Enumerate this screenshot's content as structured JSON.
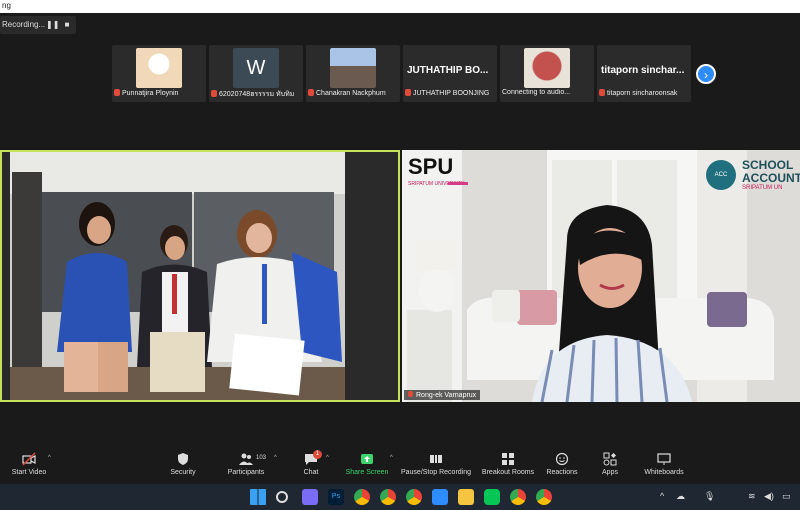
{
  "window": {
    "title": "ng"
  },
  "recording": {
    "label": "Recording...",
    "pause_icon": "pause-icon",
    "stop_icon": "stop-icon"
  },
  "participants_strip": [
    {
      "name": "Punnatjira Ploynin",
      "kind": "image",
      "color": "#e8c8a8"
    },
    {
      "name": "62020748ฮรรรรม ทับทิม",
      "kind": "avatar",
      "avatar_letter": "W",
      "color": "#3b4a55"
    },
    {
      "name": "Chanakran Nackphum",
      "kind": "image",
      "color": "#8ea4c2"
    },
    {
      "name": "JUTHATHIP BOONJING",
      "kind": "text",
      "display": "JUTHATHIP BO..."
    },
    {
      "name": "Connecting to audio...",
      "kind": "image",
      "color": "#c3524f"
    },
    {
      "name": "titaporn sincharoonsak",
      "kind": "text",
      "display": "titaporn sinchar..."
    }
  ],
  "strip_next_icon": "chevron-right-icon",
  "main_video_right": {
    "name": "Rong-ek Varnaprux",
    "logo_spu": "SPU",
    "logo_spu_sub": "SRIPATUM UNIVERSITY",
    "logo_school_line1": "SCHOOL",
    "logo_school_line2": "ACCOUNT",
    "logo_school_sub": "SRIPATUM UN",
    "logo_acc": "ACC"
  },
  "toolbar": {
    "start_video": "Start Video",
    "security": "Security",
    "participants": "Participants",
    "participants_count": "103",
    "chat": "Chat",
    "chat_badge": "1",
    "share_screen": "Share Screen",
    "pause_stop_recording": "Pause/Stop Recording",
    "breakout_rooms": "Breakout Rooms",
    "reactions": "Reactions",
    "apps": "Apps",
    "whiteboards": "Whiteboards"
  },
  "colors": {
    "active_speaker_border": "#c3e25a",
    "share_green": "#3cd36f",
    "zoom_blue": "#2d8cff",
    "mic_muted_red": "#e04a3a"
  }
}
